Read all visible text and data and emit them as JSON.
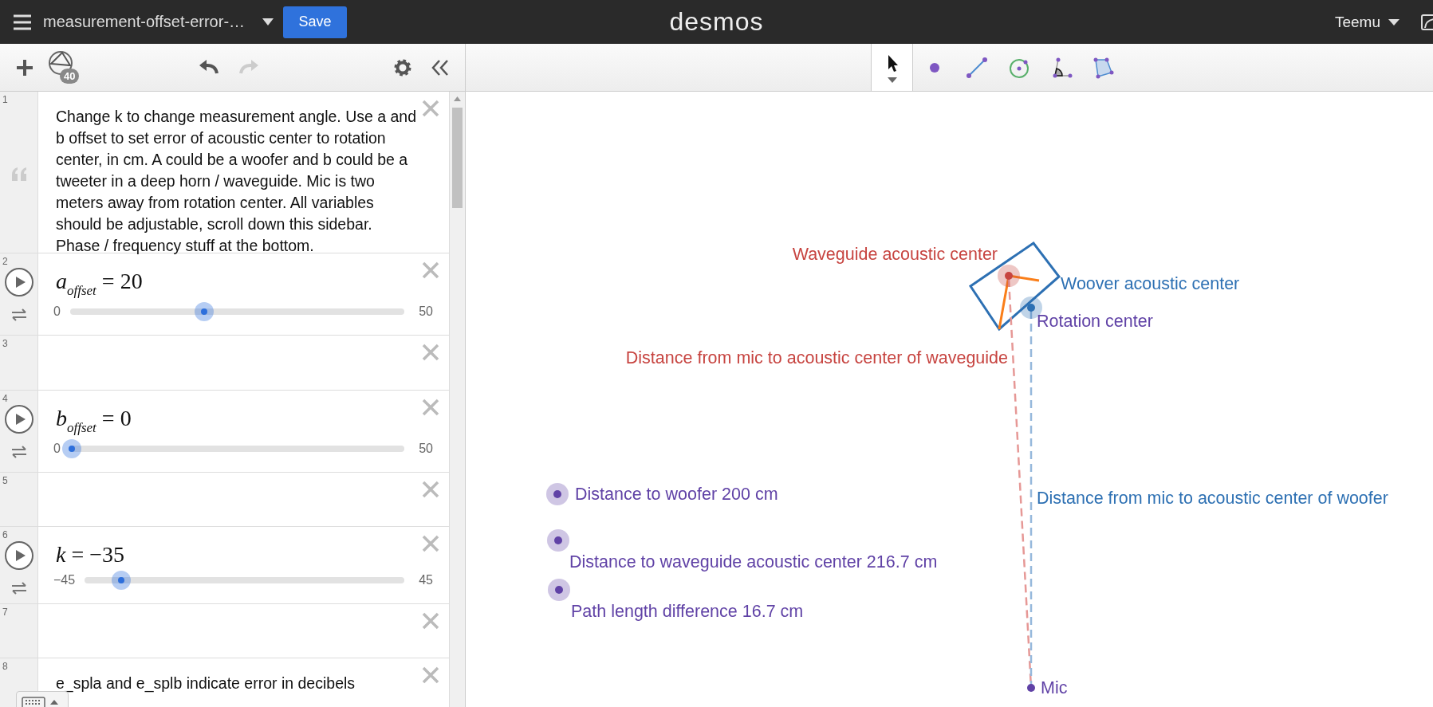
{
  "header": {
    "title": "measurement-offset-error-…",
    "save": "Save",
    "logo": "desmos",
    "user": "Teemu"
  },
  "sidebar_toolbar": {
    "expression_count": "40"
  },
  "tools": [
    {
      "kind": "pointer",
      "selected": true
    },
    {
      "kind": "point",
      "selected": false
    },
    {
      "kind": "segment",
      "selected": false
    },
    {
      "kind": "circle",
      "selected": false
    },
    {
      "kind": "angle",
      "selected": false
    },
    {
      "kind": "polygon",
      "selected": false
    }
  ],
  "expressions": [
    {
      "number": "1",
      "kind": "note",
      "text": "Change k to change measurement angle. Use a and b offset to set error of acoustic center to rotation center, in cm. A could be a woofer and b could be a tweeter in a deep horn / waveguide. Mic is two meters away from rotation center. All variables should be adjustable, scroll down this sidebar. Phase / frequency stuff at the bottom."
    },
    {
      "number": "2",
      "kind": "slider",
      "variable": "a",
      "subscript": "offset",
      "operator": "=",
      "value": "20",
      "min": "0",
      "max": "50",
      "level": 0.4
    },
    {
      "number": "3",
      "kind": "empty"
    },
    {
      "number": "4",
      "kind": "slider",
      "variable": "b",
      "subscript": "offset",
      "operator": "=",
      "value": "0",
      "min": "0",
      "max": "50",
      "level": 0
    },
    {
      "number": "5",
      "kind": "empty"
    },
    {
      "number": "6",
      "kind": "slider",
      "variable": "k",
      "operator": "=",
      "value": "−35",
      "min": "−45",
      "max": "45",
      "level": 0.111
    },
    {
      "number": "7",
      "kind": "empty"
    },
    {
      "number": "8",
      "kind": "note",
      "text": "e_spla and e_splb indicate error in decibels"
    }
  ],
  "graph": {
    "points": [
      {
        "kind": "draggable",
        "color": "#c74440"
      },
      {
        "kind": "draggable",
        "color": "#2d70b3"
      },
      {
        "kind": "draggable",
        "color": "#6042a6"
      },
      {
        "kind": "draggable",
        "color": "#6042a6"
      },
      {
        "kind": "draggable",
        "color": "#6042a6"
      },
      {
        "kind": "fixed",
        "color": "#6042a6"
      }
    ],
    "labels": [
      {
        "text": "Waveguide acoustic center",
        "color": "#c74440"
      },
      {
        "text": "Woover acoustic center",
        "color": "#2d70b3"
      },
      {
        "text": "Rotation center",
        "color": "#6042a6"
      },
      {
        "text": "Distance from mic to acoustic center of waveguide",
        "color": "#c74440"
      },
      {
        "text": "Distance to woofer 200 cm",
        "color": "#6042a6"
      },
      {
        "text": "Distance from mic to acoustic center of woofer",
        "color": "#2d70b3"
      },
      {
        "text": "Distance to waveguide acoustic center 216.7 cm",
        "color": "#6042a6"
      },
      {
        "text": "Path length difference 16.7 cm",
        "color": "#6042a6"
      },
      {
        "text": "Mic",
        "color": "#6042a6"
      }
    ]
  }
}
